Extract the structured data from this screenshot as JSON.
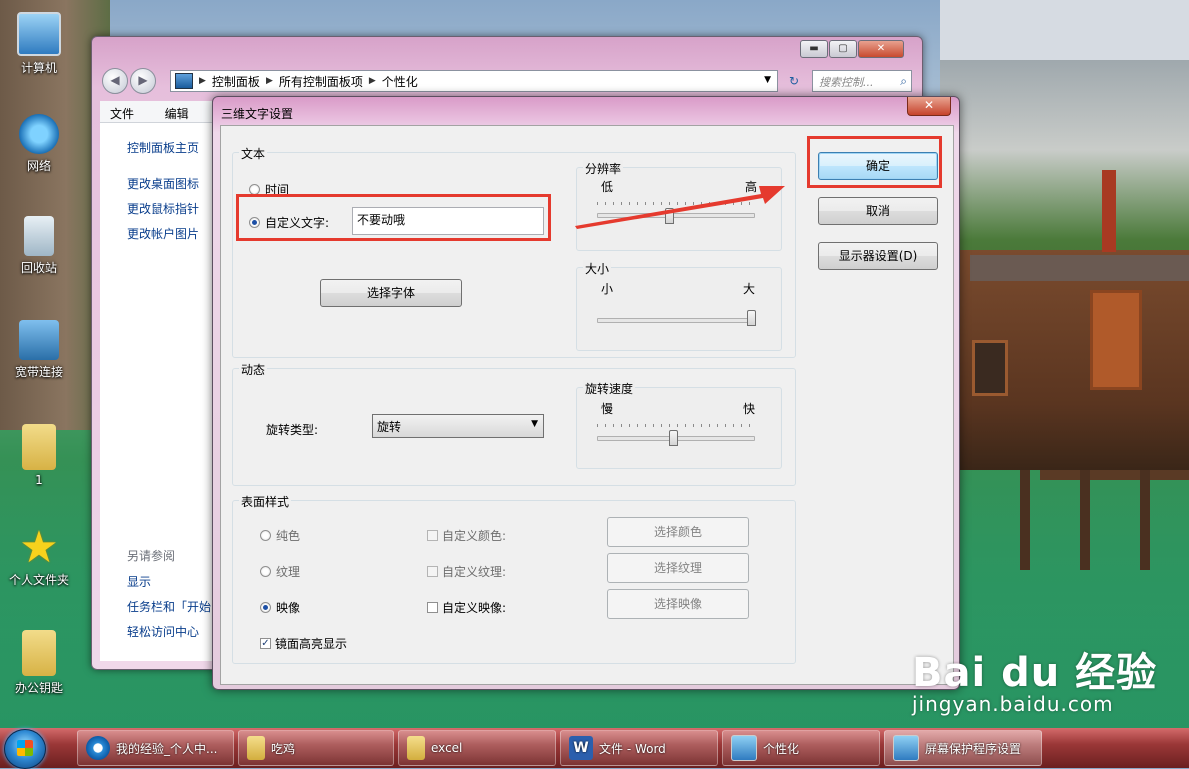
{
  "desktop": {
    "icons": [
      {
        "label": "计算机",
        "icon": "computer-icon"
      },
      {
        "label": "网络",
        "icon": "network-icon"
      },
      {
        "label": "回收站",
        "icon": "recycle-bin-icon"
      },
      {
        "label": "宽带连接",
        "icon": "broadband-icon"
      },
      {
        "label": "1",
        "icon": "folder-icon"
      },
      {
        "label": "个人文件夹",
        "icon": "star-icon"
      },
      {
        "label": "办公钥匙",
        "icon": "folder-icon"
      }
    ]
  },
  "explorer": {
    "breadcrumb": [
      "控制面板",
      "所有控制面板项",
      "个性化"
    ],
    "search_placeholder": "搜索控制...",
    "menu": [
      "文件(F)",
      "编辑(E)"
    ],
    "left_links": [
      "控制面板主页",
      "更改桌面图标",
      "更改鼠标指针",
      "更改帐户图片"
    ],
    "see_also_heading": "另请参阅",
    "see_also_links": [
      "显示",
      "任务栏和「开始",
      "轻松访问中心"
    ],
    "window_controls": {
      "minimize": "▬",
      "maximize": "▢",
      "close": "✕"
    }
  },
  "dialog": {
    "title": "三维文字设置",
    "close_label": "✕",
    "text_group": {
      "label": "文本",
      "time_option": "时间",
      "custom_option": "自定义文字:",
      "custom_value": "不要动哦",
      "selected": "custom",
      "choose_font": "选择字体",
      "resolution": {
        "label": "分辨率",
        "low": "低",
        "high": "高",
        "level": 0.45
      },
      "size": {
        "label": "大小",
        "small": "小",
        "large": "大",
        "level": 1.0
      }
    },
    "motion_group": {
      "label": "动态",
      "rotation_type_label": "旋转类型:",
      "rotation_type_value": "旋转",
      "speed": {
        "label": "旋转速度",
        "slow": "慢",
        "fast": "快",
        "level": 0.48
      }
    },
    "surface_group": {
      "label": "表面样式",
      "options": [
        "纯色",
        "纹理",
        "映像"
      ],
      "selected": "映像",
      "custom_checks": [
        "自定义颜色:",
        "自定义纹理:",
        "自定义映像:"
      ],
      "buttons": [
        "选择颜色",
        "选择纹理",
        "选择映像"
      ],
      "mirror_highlight": "镜面高亮显示",
      "mirror_highlight_checked": true
    },
    "buttons": {
      "ok": "确定",
      "cancel": "取消",
      "display_settings": "显示器设置(D)"
    }
  },
  "taskbar": {
    "tasks": [
      {
        "label": "我的经验_个人中...",
        "icon": "browser-icon"
      },
      {
        "label": "吃鸡",
        "icon": "folder-icon"
      },
      {
        "label": "excel",
        "icon": "folder-icon"
      },
      {
        "label": "文件 - Word",
        "icon": "word-icon"
      },
      {
        "label": "个性化",
        "icon": "display-icon"
      },
      {
        "label": "屏幕保护程序设置",
        "icon": "display-icon"
      }
    ]
  },
  "watermark": {
    "main": "Bai du 经验",
    "sub": "jingyan.baidu.com"
  },
  "colors": {
    "annotation_red": "#e53a2e",
    "taskbar": "#9b3838",
    "link": "#0a3e8c"
  }
}
